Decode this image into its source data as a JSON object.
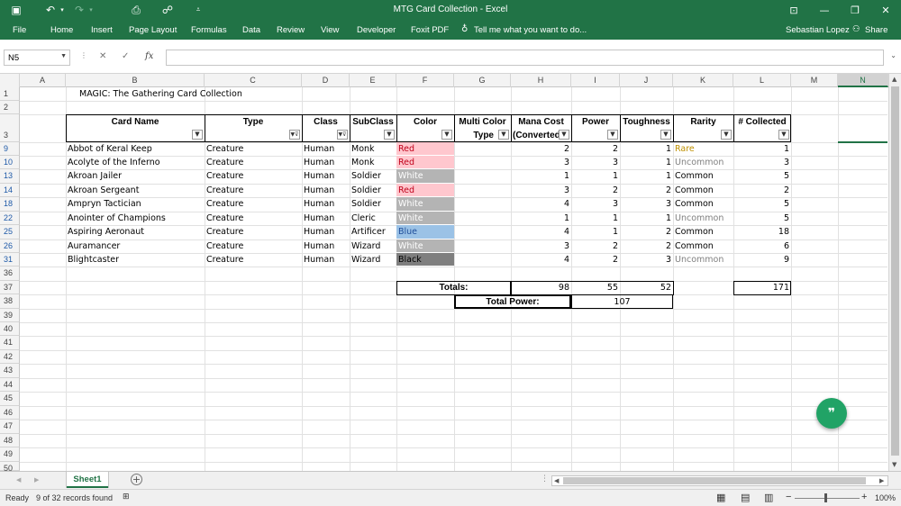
{
  "window": {
    "title": "MTG Card Collection - Excel",
    "user": "Sebastian Lopez",
    "share": "Share"
  },
  "ribbon": {
    "tabs": [
      "File",
      "Home",
      "Insert",
      "Page Layout",
      "Formulas",
      "Data",
      "Review",
      "View",
      "Developer",
      "Foxit PDF"
    ],
    "tell_me": "Tell me what you want to do..."
  },
  "formula_bar": {
    "name_box": "N5",
    "fx": "fx",
    "value": ""
  },
  "columns": [
    "A",
    "B",
    "C",
    "D",
    "E",
    "F",
    "G",
    "H",
    "I",
    "J",
    "K",
    "L",
    "M",
    "N"
  ],
  "selected_column": "N",
  "rows": [
    "1",
    "2",
    "3",
    "9",
    "10",
    "13",
    "14",
    "18",
    "22",
    "25",
    "26",
    "31",
    "36",
    "37",
    "38",
    "39",
    "40",
    "41",
    "42",
    "43",
    "44",
    "45",
    "46",
    "47",
    "48",
    "49",
    "50"
  ],
  "sheet_title": "MAGIC: The Gathering Card Collection",
  "table_headers": {
    "name": "Card Name",
    "type": "Type",
    "class": "Class",
    "subclass": "SubClass",
    "color": "Color",
    "multi1": "Multi Color",
    "multi2": "Type",
    "mana1": "Mana Cost",
    "mana2": "(Converted",
    "power": "Power",
    "toughness": "Toughness",
    "rarity": "Rarity",
    "collected": "# Collected"
  },
  "cards": [
    {
      "name": "Abbot of Keral Keep",
      "type": "Creature",
      "class": "Human",
      "subclass": "Monk",
      "color": "Red",
      "mana": "2",
      "power": "2",
      "toughness": "1",
      "rarity": "Rare",
      "collected": "1"
    },
    {
      "name": "Acolyte of the Inferno",
      "type": "Creature",
      "class": "Human",
      "subclass": "Monk",
      "color": "Red",
      "mana": "3",
      "power": "3",
      "toughness": "1",
      "rarity": "Uncommon",
      "collected": "3"
    },
    {
      "name": "Akroan Jailer",
      "type": "Creature",
      "class": "Human",
      "subclass": "Soldier",
      "color": "White",
      "mana": "1",
      "power": "1",
      "toughness": "1",
      "rarity": "Common",
      "collected": "5"
    },
    {
      "name": "Akroan Sergeant",
      "type": "Creature",
      "class": "Human",
      "subclass": "Soldier",
      "color": "Red",
      "mana": "3",
      "power": "2",
      "toughness": "2",
      "rarity": "Common",
      "collected": "2"
    },
    {
      "name": "Ampryn Tactician",
      "type": "Creature",
      "class": "Human",
      "subclass": "Soldier",
      "color": "White",
      "mana": "4",
      "power": "3",
      "toughness": "3",
      "rarity": "Common",
      "collected": "5"
    },
    {
      "name": "Anointer of Champions",
      "type": "Creature",
      "class": "Human",
      "subclass": "Cleric",
      "color": "White",
      "mana": "1",
      "power": "1",
      "toughness": "1",
      "rarity": "Uncommon",
      "collected": "5"
    },
    {
      "name": "Aspiring Aeronaut",
      "type": "Creature",
      "class": "Human",
      "subclass": "Artificer",
      "color": "Blue",
      "mana": "4",
      "power": "1",
      "toughness": "2",
      "rarity": "Common",
      "collected": "18"
    },
    {
      "name": "Auramancer",
      "type": "Creature",
      "class": "Human",
      "subclass": "Wizard",
      "color": "White",
      "mana": "3",
      "power": "2",
      "toughness": "2",
      "rarity": "Common",
      "collected": "6"
    },
    {
      "name": "Blightcaster",
      "type": "Creature",
      "class": "Human",
      "subclass": "Wizard",
      "color": "Black",
      "mana": "4",
      "power": "2",
      "toughness": "3",
      "rarity": "Uncommon",
      "collected": "9"
    }
  ],
  "totals": {
    "label": "Totals:",
    "mana": "98",
    "power": "55",
    "toughness": "52",
    "collected": "171",
    "power_label": "Total Power:",
    "power_value": "107"
  },
  "colors": {
    "excel_green": "#217346",
    "red_fill": "#ffc7ce",
    "red_text": "#c0001a",
    "white_fill": "#b4b4b4",
    "white_text": "#ffffff",
    "blue_fill": "#9bc2e6",
    "blue_text": "#1f4e9a",
    "black_fill": "#7f7f7f",
    "black_text": "#000000",
    "rare_text": "#bf9000",
    "uncommon_text": "#808080",
    "common_text": "#000000"
  },
  "sheet_tab": "Sheet1",
  "status": {
    "ready": "Ready",
    "records": "9 of 32 records found",
    "zoom": "100%"
  }
}
